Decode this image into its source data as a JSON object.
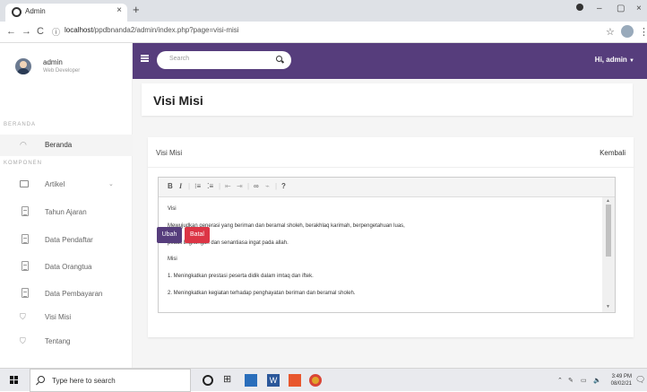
{
  "browser": {
    "tab_title": "Admin",
    "tab_close": "×",
    "new_tab": "+",
    "url_host": "localhost",
    "url_path": "/ppdbnanda2/admin/index.php?page=visi-misi",
    "window_minimize": "–",
    "window_maximize": "▢",
    "window_close": "×"
  },
  "sidebar": {
    "user_name": "admin",
    "user_role": "Web Developer",
    "section_beranda": "BERANDA",
    "section_komponen": "KOMPONEN",
    "items": [
      {
        "label": "Beranda",
        "icon": "gauge-icon"
      },
      {
        "label": "Artikel",
        "icon": "window-icon"
      },
      {
        "label": "Tahun Ajaran",
        "icon": "document-icon"
      },
      {
        "label": "Data Pendaftar",
        "icon": "document-icon"
      },
      {
        "label": "Data Orangtua",
        "icon": "document-icon"
      },
      {
        "label": "Data Pembayaran",
        "icon": "document-icon"
      },
      {
        "label": "Visi Misi",
        "icon": "shield-icon"
      },
      {
        "label": "Tentang",
        "icon": "shield-icon"
      }
    ]
  },
  "topnav": {
    "search_placeholder": "Search",
    "user_greeting": "Hi, admin",
    "accent": "#563d7c"
  },
  "page": {
    "title": "Visi Misi",
    "card_title": "Visi Misi",
    "back_link": "Kembali",
    "editor_lines": [
      "Visi",
      "Mewujudkan generasi yang beriman dan beramal sholeh, berakhlaq karimah, berpengetahuan luas,",
      "peduli lingkungan dan senantiasa ingat pada allah.",
      "Misi",
      "1. Meningkatkan prestasi peserta didik dalam imtaq dan iftek.",
      "2. Meningkatkan kegiatan terhadap penghayatan beriman dan beramal sholeh."
    ],
    "save_button": "Ubah",
    "cancel_button": "Batal",
    "cancel_color": "#dc3545"
  },
  "taskbar": {
    "search_text": "Type here to search",
    "time": "3:49 PM",
    "date": "08/02/21"
  }
}
